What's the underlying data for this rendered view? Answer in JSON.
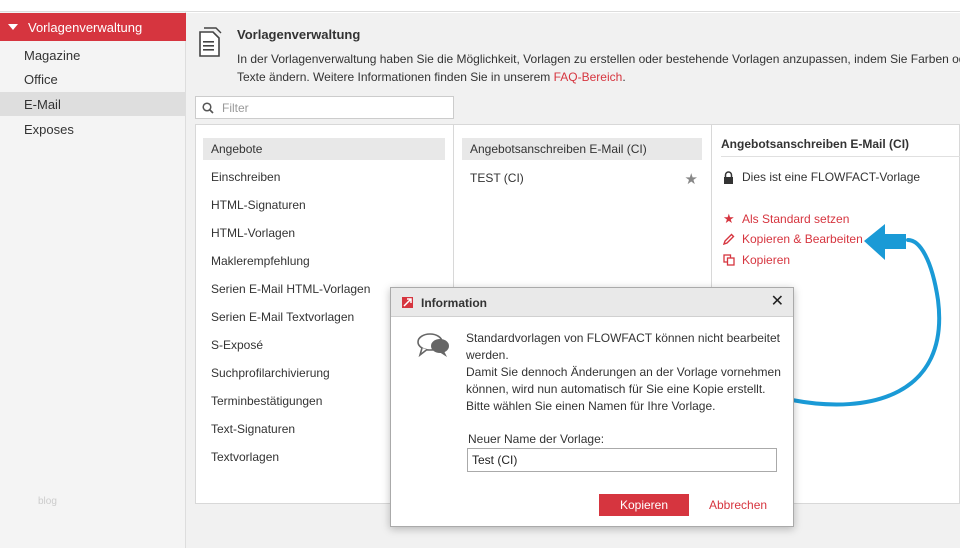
{
  "sidebar": {
    "header": "Vorlagenverwaltung",
    "items": [
      {
        "label": "Magazine"
      },
      {
        "label": "Office"
      },
      {
        "label": "E-Mail",
        "active": true
      },
      {
        "label": "Exposes"
      }
    ],
    "watermark": "blog"
  },
  "header": {
    "title": "Vorlagenverwaltung",
    "desc_line1": "In der Vorlagenverwaltung haben Sie die Möglichkeit, Vorlagen zu erstellen oder bestehende Vorlagen anzupassen, indem Sie Farben oder",
    "desc_line2": "Texte ändern. Weitere Informationen finden Sie in unserem ",
    "faq_link": "FAQ-Bereich",
    "desc_end": "."
  },
  "filter": {
    "placeholder": "Filter"
  },
  "categories": [
    "Angebote",
    "Einschreiben",
    "HTML-Signaturen",
    "HTML-Vorlagen",
    "Maklerempfehlung",
    "Serien E-Mail HTML-Vorlagen",
    "Serien E-Mail Textvorlagen",
    "S-Exposé",
    "Suchprofilarchivierung",
    "Terminbestätigungen",
    "Text-Signaturen",
    "Textvorlagen"
  ],
  "templates": {
    "group": "Angebotsanschreiben E-Mail (CI)",
    "item": "TEST (CI)"
  },
  "details": {
    "title": "Angebotsanschreiben E-Mail (CI)",
    "lock_text": "Dies ist eine FLOWFACT-Vorlage",
    "actions": [
      "Als Standard setzen",
      "Kopieren & Bearbeiten",
      "Kopieren"
    ]
  },
  "dialog": {
    "title": "Information",
    "close": "✕",
    "msg_lines": [
      "Standardvorlagen von FLOWFACT können nicht bearbeitet",
      "werden.",
      "Damit Sie dennoch Änderungen an der Vorlage vornehmen",
      "können, wird nun automatisch für Sie eine Kopie erstellt.",
      "Bitte wählen Sie einen Namen für Ihre Vorlage."
    ],
    "name_label": "Neuer Name der Vorlage:",
    "name_value": "Test (CI)",
    "primary_button": "Kopieren",
    "secondary_button": "Abbrechen"
  },
  "colors": {
    "accent": "#d6353f",
    "arrow": "#1a9ad6"
  }
}
